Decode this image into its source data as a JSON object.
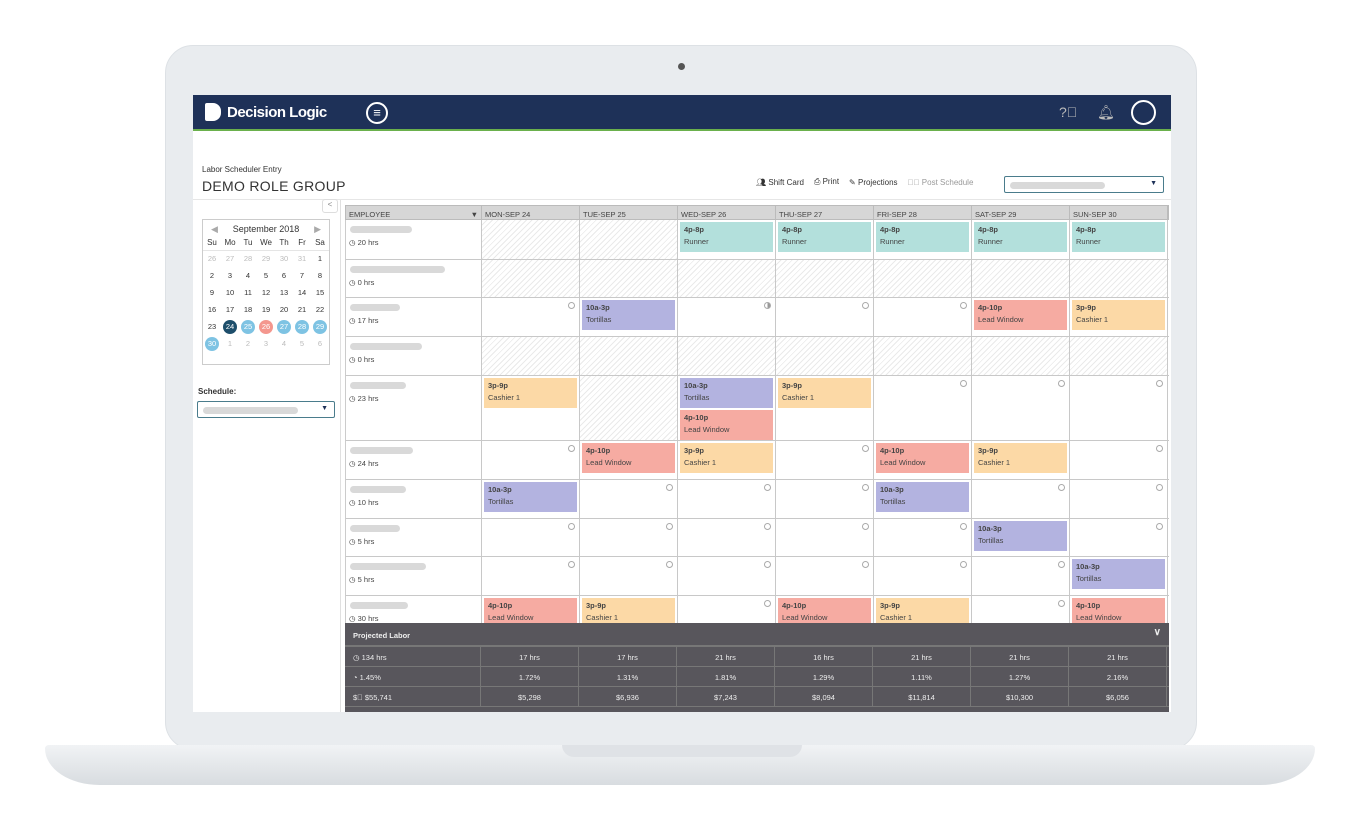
{
  "app": {
    "brand": "Decision Logic"
  },
  "header": {
    "subtitle": "Labor Scheduler Entry",
    "title": "DEMO ROLE GROUP"
  },
  "toolbar": {
    "shift_card": "Shift Card",
    "print": "Print",
    "projections": "Projections",
    "post_schedule": "Post Schedule"
  },
  "calendar": {
    "month": "September 2018",
    "weekdays": [
      "Su",
      "Mo",
      "Tu",
      "We",
      "Th",
      "Fr",
      "Sa"
    ],
    "weeks": [
      [
        "26",
        "27",
        "28",
        "29",
        "30",
        "31",
        "1"
      ],
      [
        "2",
        "3",
        "4",
        "5",
        "6",
        "7",
        "8"
      ],
      [
        "9",
        "10",
        "11",
        "12",
        "13",
        "14",
        "15"
      ],
      [
        "16",
        "17",
        "18",
        "19",
        "20",
        "21",
        "22"
      ],
      [
        "23",
        "24",
        "25",
        "26",
        "27",
        "28",
        "29"
      ],
      [
        "30",
        "1",
        "2",
        "3",
        "4",
        "5",
        "6"
      ]
    ]
  },
  "schedule_label": "Schedule:",
  "grid": {
    "employee_header": "EMPLOYEE",
    "days": [
      "MON-SEP 24",
      "TUE-SEP 25",
      "WED-SEP 26",
      "THU-SEP 27",
      "FRI-SEP 28",
      "SAT-SEP 29",
      "SUN-SEP 30"
    ],
    "rows": [
      {
        "hours": "20 hrs",
        "cells": [
          {
            "off": true
          },
          {
            "off": true
          },
          {
            "shifts": [
              {
                "time": "4p-8p",
                "role": "Runner"
              }
            ]
          },
          {
            "shifts": [
              {
                "time": "4p-8p",
                "role": "Runner"
              }
            ]
          },
          {
            "shifts": [
              {
                "time": "4p-8p",
                "role": "Runner"
              }
            ]
          },
          {
            "shifts": [
              {
                "time": "4p-8p",
                "role": "Runner"
              }
            ]
          },
          {
            "shifts": [
              {
                "time": "4p-8p",
                "role": "Runner"
              }
            ]
          }
        ]
      },
      {
        "hours": "0 hrs",
        "cells": [
          {
            "off": true
          },
          {
            "off": true
          },
          {
            "off": true
          },
          {
            "off": true
          },
          {
            "off": true
          },
          {
            "off": true
          },
          {
            "off": true
          }
        ]
      },
      {
        "hours": "17 hrs",
        "cells": [
          {
            "status": "empty"
          },
          {
            "shifts": [
              {
                "time": "10a-3p",
                "role": "Tortillas"
              }
            ]
          },
          {
            "status": "half"
          },
          {
            "status": "empty"
          },
          {
            "status": "empty"
          },
          {
            "shifts": [
              {
                "time": "4p-10p",
                "role": "Lead Window"
              }
            ]
          },
          {
            "shifts": [
              {
                "time": "3p-9p",
                "role": "Cashier 1"
              }
            ]
          }
        ]
      },
      {
        "hours": "0 hrs",
        "cells": [
          {
            "off": true
          },
          {
            "off": true
          },
          {
            "off": true
          },
          {
            "off": true
          },
          {
            "off": true
          },
          {
            "off": true
          },
          {
            "off": true
          }
        ]
      },
      {
        "hours": "23 hrs",
        "cells": [
          {
            "shifts": [
              {
                "time": "3p-9p",
                "role": "Cashier 1"
              }
            ]
          },
          {
            "off": true
          },
          {
            "shifts": [
              {
                "time": "10a-3p",
                "role": "Tortillas"
              },
              {
                "time": "4p-10p",
                "role": "Lead Window"
              }
            ]
          },
          {
            "shifts": [
              {
                "time": "3p-9p",
                "role": "Cashier 1"
              }
            ]
          },
          {
            "status": "empty"
          },
          {
            "status": "empty"
          },
          {
            "status": "empty"
          }
        ]
      },
      {
        "hours": "24 hrs",
        "cells": [
          {
            "status": "empty"
          },
          {
            "shifts": [
              {
                "time": "4p-10p",
                "role": "Lead Window"
              }
            ]
          },
          {
            "shifts": [
              {
                "time": "3p-9p",
                "role": "Cashier 1"
              }
            ]
          },
          {
            "status": "empty"
          },
          {
            "shifts": [
              {
                "time": "4p-10p",
                "role": "Lead Window"
              }
            ]
          },
          {
            "shifts": [
              {
                "time": "3p-9p",
                "role": "Cashier 1"
              }
            ]
          },
          {
            "status": "empty"
          }
        ]
      },
      {
        "hours": "10 hrs",
        "cells": [
          {
            "shifts": [
              {
                "time": "10a-3p",
                "role": "Tortillas"
              }
            ]
          },
          {
            "status": "empty"
          },
          {
            "status": "empty"
          },
          {
            "status": "empty"
          },
          {
            "shifts": [
              {
                "time": "10a-3p",
                "role": "Tortillas"
              }
            ]
          },
          {
            "status": "empty"
          },
          {
            "status": "empty"
          }
        ]
      },
      {
        "hours": "5 hrs",
        "cells": [
          {
            "status": "empty"
          },
          {
            "status": "empty"
          },
          {
            "status": "empty"
          },
          {
            "status": "empty"
          },
          {
            "status": "empty"
          },
          {
            "shifts": [
              {
                "time": "10a-3p",
                "role": "Tortillas"
              }
            ]
          },
          {
            "status": "empty"
          }
        ]
      },
      {
        "hours": "5 hrs",
        "cells": [
          {
            "status": "empty"
          },
          {
            "status": "empty"
          },
          {
            "status": "empty"
          },
          {
            "status": "empty"
          },
          {
            "status": "empty"
          },
          {
            "status": "empty"
          },
          {
            "shifts": [
              {
                "time": "10a-3p",
                "role": "Tortillas"
              }
            ]
          }
        ]
      },
      {
        "hours": "30 hrs",
        "cells": [
          {
            "shifts": [
              {
                "time": "4p-10p",
                "role": "Lead Window"
              }
            ]
          },
          {
            "shifts": [
              {
                "time": "3p-9p",
                "role": "Cashier 1"
              }
            ]
          },
          {
            "status": "empty"
          },
          {
            "shifts": [
              {
                "time": "4p-10p",
                "role": "Lead Window"
              }
            ]
          },
          {
            "shifts": [
              {
                "time": "3p-9p",
                "role": "Cashier 1"
              }
            ]
          },
          {
            "status": "empty"
          },
          {
            "shifts": [
              {
                "time": "4p-10p",
                "role": "Lead Window"
              }
            ]
          }
        ]
      }
    ]
  },
  "role_colors": {
    "Runner": "#b3e0dc",
    "Tortillas": "#b3b3e0",
    "Lead Window": "#f6aba2",
    "Cashier 1": "#fcd9a6"
  },
  "projected": {
    "title": "Projected Labor",
    "rows": [
      {
        "icon": "clock-icon",
        "total": "134 hrs",
        "values": [
          "17 hrs",
          "17 hrs",
          "21 hrs",
          "16 hrs",
          "21 hrs",
          "21 hrs",
          "21 hrs"
        ]
      },
      {
        "icon": "pie-icon",
        "total": "1.45%",
        "values": [
          "1.72%",
          "1.31%",
          "1.81%",
          "1.29%",
          "1.11%",
          "1.27%",
          "2.16%"
        ]
      },
      {
        "icon": "dollar-icon",
        "total": "$55,741",
        "values": [
          "$5,298",
          "$6,936",
          "$7,243",
          "$8,094",
          "$11,814",
          "$10,300",
          "$6,056"
        ]
      }
    ]
  },
  "colors": {
    "header": "#1e3158",
    "accent": "#6ab04c",
    "selected_day": "#1d4e6b",
    "week_day": "#7ec3e3",
    "today": "#f4978e"
  }
}
